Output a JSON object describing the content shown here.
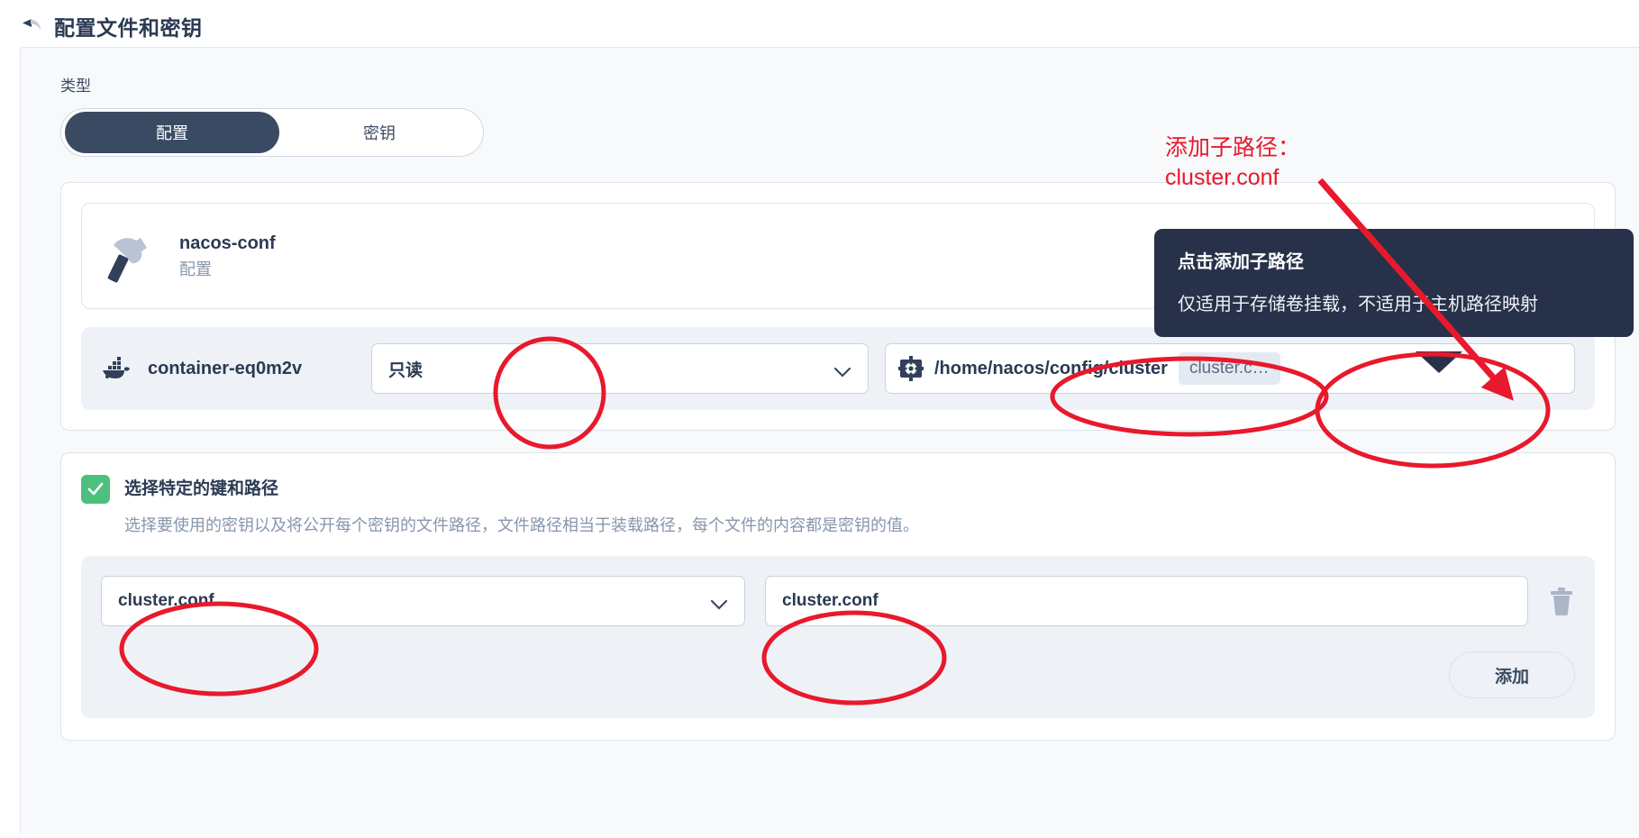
{
  "header": {
    "back_icon": "back-arrow-icon",
    "title": "配置文件和密钥"
  },
  "form": {
    "type_label": "类型",
    "type_options": [
      {
        "label": "配置",
        "selected": true
      },
      {
        "label": "密钥",
        "selected": false
      }
    ]
  },
  "resource": {
    "icon": "hammer-icon",
    "name": "nacos-conf",
    "kind": "配置"
  },
  "container": {
    "icon": "docker-icon",
    "name": "container-eq0m2v",
    "access_mode": "只读",
    "path_icon": "cog-icon",
    "mount_path": "/home/nacos/config/cluster",
    "subpath_chip": "cluster.c…"
  },
  "keys": {
    "checkbox_checked": true,
    "title": "选择特定的键和路径",
    "description": "选择要使用的密钥以及将公开每个密钥的文件路径，文件路径相当于装载路径，每个文件的内容都是密钥的值。",
    "rows": [
      {
        "key": "cluster.conf",
        "path": "cluster.conf"
      }
    ],
    "delete_icon": "trash-icon",
    "add_label": "添加"
  },
  "tooltip": {
    "title": "点击添加子路径",
    "body": "仅适用于存储卷挂载，不适用于主机路径映射"
  },
  "annotation": {
    "text": "添加子路径：\ncluster.conf",
    "color": "#e8192c"
  },
  "colors": {
    "accent_dark": "#3b4a63",
    "panel_bg": "#f7f9fb",
    "row_bg": "#eef2f7",
    "check_green": "#4ec07e",
    "tooltip_bg": "#27314a",
    "annotation_red": "#e8192c"
  }
}
